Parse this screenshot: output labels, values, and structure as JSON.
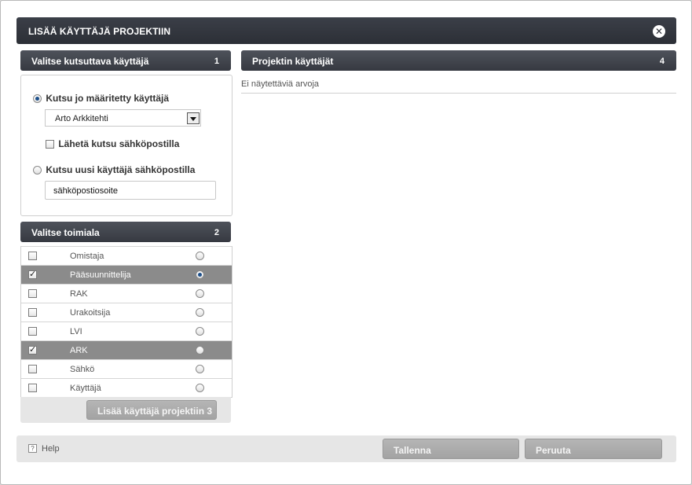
{
  "dialog": {
    "title": "LISÄÄ KÄYTTÄJÄ PROJEKTIIN",
    "close_icon": "close-icon"
  },
  "section_invite": {
    "title": "Valitse kutsuttava käyttäjä",
    "step": "1",
    "option_existing": {
      "label": "Kutsu jo määritetty käyttäjä",
      "selected": true
    },
    "user_select": {
      "value": "Arto Arkkitehti"
    },
    "send_email": {
      "label": "Lähetä kutsu sähköpostilla",
      "checked": false
    },
    "option_new": {
      "label": "Kutsu uusi käyttäjä sähköpostilla",
      "selected": false
    },
    "email_input": {
      "value": "sähköpostiosoite"
    }
  },
  "section_role": {
    "title": "Valitse toimiala",
    "step": "2",
    "roles": [
      {
        "name": "Omistaja",
        "checked": false,
        "primary": false,
        "highlight": false
      },
      {
        "name": "Pääsuunnittelija",
        "checked": true,
        "primary": true,
        "highlight": true
      },
      {
        "name": "RAK",
        "checked": false,
        "primary": false,
        "highlight": false
      },
      {
        "name": "Urakoitsija",
        "checked": false,
        "primary": false,
        "highlight": false
      },
      {
        "name": "LVI",
        "checked": false,
        "primary": false,
        "highlight": false
      },
      {
        "name": "ARK",
        "checked": true,
        "primary": false,
        "highlight": true
      },
      {
        "name": "Sähkö",
        "checked": false,
        "primary": false,
        "highlight": false
      },
      {
        "name": "Käyttäjä",
        "checked": false,
        "primary": false,
        "highlight": false
      }
    ],
    "add_button": "Lisää käyttäjä projektiin 3"
  },
  "section_users": {
    "title": "Projektin käyttäjät",
    "step": "4",
    "empty_message": "Ei näytettäviä arvoja"
  },
  "footer": {
    "help_label": "Help",
    "save_label": "Tallenna",
    "cancel_label": "Peruuta"
  },
  "colors": {
    "header_dark": "#2c2f36",
    "section_header": "#363941",
    "selected_row": "#8b8b8b",
    "button_gray": "#a3a3a3"
  }
}
